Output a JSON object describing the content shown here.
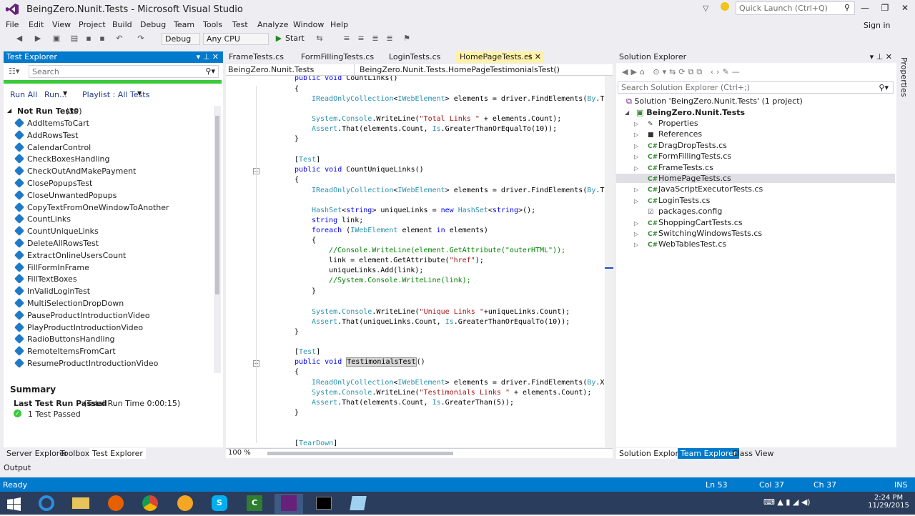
{
  "window": {
    "title": "BeingZero.Nunit.Tests - Microsoft Visual Studio",
    "quick_launch": "Quick Launch (Ctrl+Q)",
    "sign_in": "Sign in"
  },
  "menu": [
    "File",
    "Edit",
    "View",
    "Project",
    "Build",
    "Debug",
    "Team",
    "Tools",
    "Test",
    "Analyze",
    "Window",
    "Help"
  ],
  "toolbar": {
    "config": "Debug",
    "platform": "Any CPU",
    "start": "Start"
  },
  "test_explorer": {
    "header": "Test Explorer",
    "search_placeholder": "Search",
    "run_all": "Run All",
    "run": "Run...",
    "playlist": "Playlist : All Tests",
    "group_label": "Not Run Tests",
    "group_count": "(30)",
    "tests": [
      "AddItemsToCart",
      "AddRowsTest",
      "CalendarControl",
      "CheckBoxesHandling",
      "CheckOutAndMakePayment",
      "ClosePopupsTest",
      "CloseUnwantedPopups",
      "CopyTextFromOneWindowToAnother",
      "CountLinks",
      "CountUniqueLinks",
      "DeleteAllRowsTest",
      "ExtractOnlineUsersCount",
      "FillFormInFrame",
      "FillTextBoxes",
      "InValidLoginTest",
      "MultiSelectionDropDown",
      "PauseProductIntroductionVideo",
      "PlayProductIntroductionVideo",
      "RadioButtonsHandling",
      "RemoteItemsFromCart",
      "ResumeProductIntroductionVideo"
    ],
    "summary_title": "Summary",
    "last_run": "Last Test Run Passed",
    "run_time": "(Total Run Time 0:00:15)",
    "passed": "1 Test Passed"
  },
  "left_bottom_tabs": [
    "Server Explorer",
    "Toolbox",
    "Test Explorer"
  ],
  "editor": {
    "tabs": [
      "FrameTests.cs",
      "FormFillingTests.cs",
      "LoginTests.cs",
      "HomePageTests.cs"
    ],
    "nav": [
      "BeingZero.Nunit.Tests",
      "BeingZero.Nunit.Tests.HomePage",
      "TestimonialsTest()"
    ],
    "zoom": "100 %"
  },
  "solution_explorer": {
    "header": "Solution Explorer",
    "search_placeholder": "Search Solution Explorer (Ctrl+;)",
    "solution": "Solution 'BeingZero.Nunit.Tests' (1 project)",
    "project": "BeingZero.Nunit.Tests",
    "items": [
      "Properties",
      "References",
      "DragDropTests.cs",
      "FormFillingTests.cs",
      "FrameTests.cs",
      "HomePageTests.cs",
      "JavaScriptExecutorTests.cs",
      "LoginTests.cs",
      "packages.config",
      "ShoppingCartTests.cs",
      "SwitchingWindowsTests.cs",
      "WebTablesTest.cs"
    ],
    "tabs": [
      "Solution Explorer",
      "Team Explorer",
      "Class View"
    ],
    "properties_label": "Properties"
  },
  "output_label": "Output",
  "status": {
    "ready": "Ready",
    "ln": "Ln 53",
    "col": "Col 37",
    "ch": "Ch 37",
    "ins": "INS"
  },
  "clock": {
    "time": "2:24 PM",
    "date": "11/29/2015"
  },
  "colors": {
    "accent": "#007acc",
    "pass": "#3cc93c",
    "taskbar": "#2a3d5c"
  }
}
